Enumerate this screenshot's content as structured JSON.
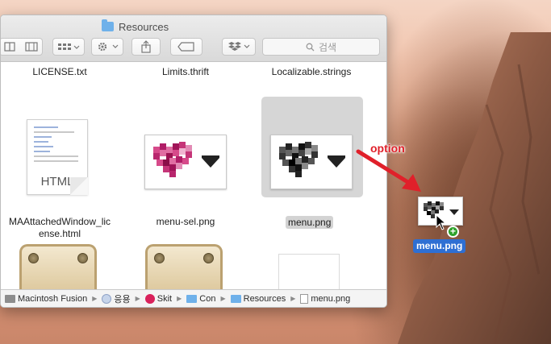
{
  "window": {
    "title": "Resources"
  },
  "toolbar": {
    "search_placeholder": "검색"
  },
  "files": [
    {
      "name": "LICENSE.txt"
    },
    {
      "name": "Limits.thrift"
    },
    {
      "name": "Localizable.strings"
    },
    {
      "name": "MAAttachedWindow_license.html",
      "name_line1": "MAAttachedWindow_lic",
      "name_line2": "ense.html",
      "icon_label": "HTML"
    },
    {
      "name": "menu-sel.png"
    },
    {
      "name": "menu.png",
      "selected": true
    }
  ],
  "pathbar": {
    "items": [
      {
        "label": "Macintosh Fusion",
        "icon": "disk-icon"
      },
      {
        "label": "응용",
        "icon": "folder-icon"
      },
      {
        "label": "Skit",
        "icon": "skitch-app-icon"
      },
      {
        "label": "Con",
        "icon": "folder-icon"
      },
      {
        "label": "Resources",
        "icon": "folder-icon"
      },
      {
        "label": "menu.png",
        "icon": "file-icon"
      }
    ]
  },
  "annotation": {
    "text": "option",
    "drag_label": "menu.png",
    "color": "#e0202a"
  },
  "colors": {
    "selection_label": "#2e6fd3",
    "copy_badge": "#2ea12b"
  }
}
